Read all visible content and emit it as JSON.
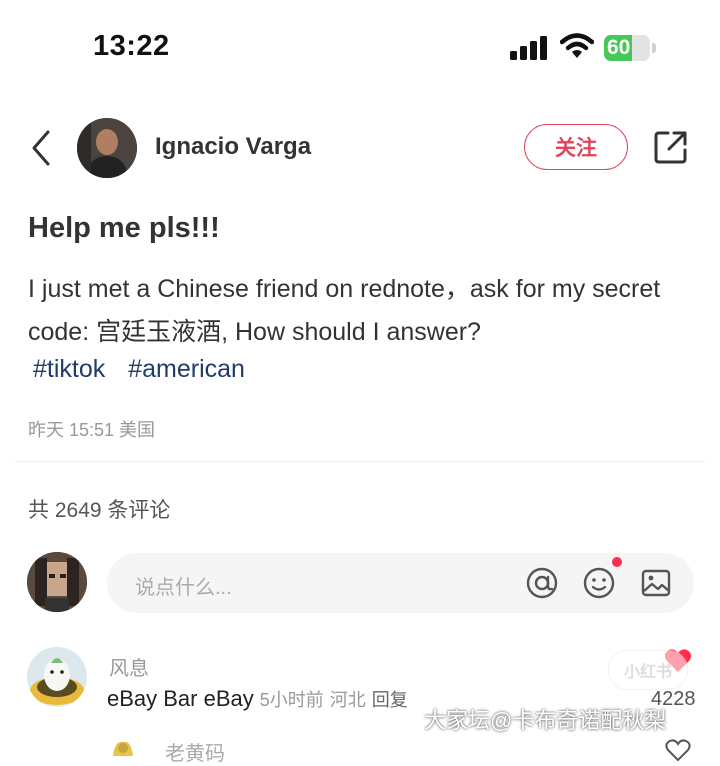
{
  "status_bar": {
    "time": "13:22",
    "battery": "60",
    "battery_level": 0.6,
    "battery_color": "#47c757"
  },
  "header": {
    "back_icon": "chevron-left-icon",
    "author_name": "Ignacio Varga",
    "follow_label": "关注",
    "follow_color": "#e0455e",
    "share_icon": "share-icon"
  },
  "post": {
    "title": "Help me pls!!!",
    "body": "I just met a Chinese friend on rednote，ask for my secret code: 宫廷玉液酒, How should I answer?",
    "tags": [
      "#tiktok",
      "#american"
    ],
    "meta": "昨天 15:51 美国"
  },
  "comments": {
    "count_text": "共 2649 条评论",
    "input_placeholder": "说点什么...",
    "input_icons": [
      "at-icon",
      "emoji-icon",
      "image-icon"
    ],
    "items": [
      {
        "name": "风息",
        "text": "eBay Bar eBay",
        "time": "5小时前",
        "location": "河北",
        "reply_label": "回复",
        "likes": "4228"
      },
      {
        "name": "老黄码"
      }
    ]
  },
  "watermark": {
    "pill_text": "小红书",
    "text": "大家坛@卡布奇诺配秋梨"
  }
}
